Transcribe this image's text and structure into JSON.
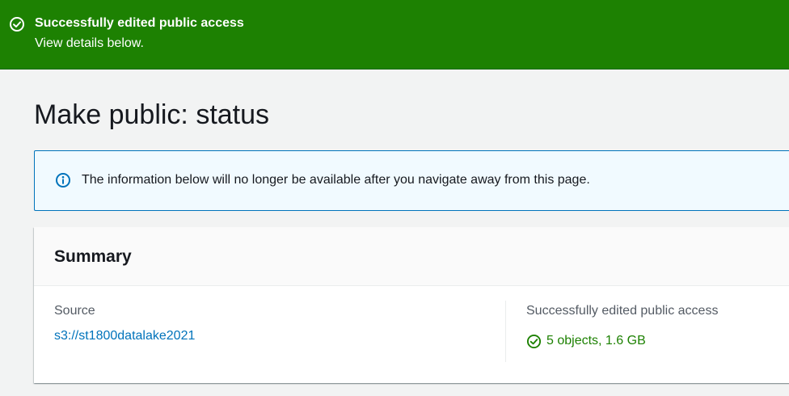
{
  "flash": {
    "header": "Successfully edited public access",
    "content": "View details below.",
    "icon": "check-circle-icon",
    "background": "#1d8102"
  },
  "page": {
    "title": "Make public: status"
  },
  "alert": {
    "icon": "info-icon",
    "text": "The information below will no longer be available after you navigate away from this page.",
    "border_color": "#0073bb"
  },
  "summary": {
    "title": "Summary",
    "source_label": "Source",
    "source_value": "s3://st1800datalake2021",
    "status_label": "Successfully edited public access",
    "status_icon": "check-circle-icon",
    "status_value": "5 objects, 1.6 GB",
    "status_color": "#1d8102",
    "link_color": "#0073bb"
  }
}
